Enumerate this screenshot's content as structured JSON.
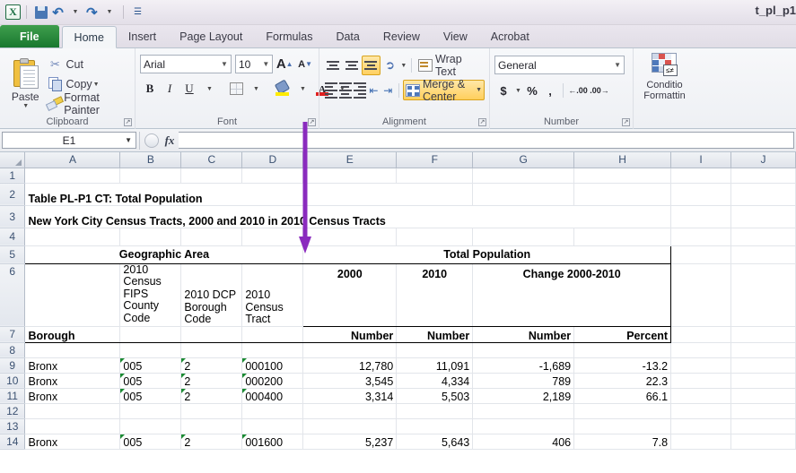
{
  "window": {
    "document_title": "t_pl_p1"
  },
  "quick_access": {
    "logo": "X",
    "items": [
      {
        "name": "save",
        "label": "Save"
      },
      {
        "name": "undo",
        "label": "Undo"
      },
      {
        "name": "redo",
        "label": "Redo"
      },
      {
        "name": "customize",
        "label": "Customize Quick Access Toolbar"
      }
    ]
  },
  "ribbon": {
    "tabs": [
      {
        "label": "File",
        "active": false,
        "file": true
      },
      {
        "label": "Home",
        "active": true
      },
      {
        "label": "Insert",
        "active": false
      },
      {
        "label": "Page Layout",
        "active": false
      },
      {
        "label": "Formulas",
        "active": false
      },
      {
        "label": "Data",
        "active": false
      },
      {
        "label": "Review",
        "active": false
      },
      {
        "label": "View",
        "active": false
      },
      {
        "label": "Acrobat",
        "active": false
      }
    ],
    "clipboard": {
      "group_label": "Clipboard",
      "paste": "Paste",
      "cut": "Cut",
      "copy": "Copy",
      "format_painter": "Format Painter"
    },
    "font": {
      "group_label": "Font",
      "font_name": "Arial",
      "font_size": "10",
      "grow_font": "A",
      "shrink_font": "A",
      "bold": "B",
      "italic": "I",
      "underline": "U",
      "font_color_letter": "A"
    },
    "alignment": {
      "group_label": "Alignment",
      "wrap_text": "Wrap Text",
      "merge_center": "Merge & Center"
    },
    "number": {
      "group_label": "Number",
      "format": "General",
      "currency": "$",
      "percent": "%",
      "comma": ",",
      "increase_decimal": ".00",
      "decrease_decimal": ".00"
    },
    "styles": {
      "conditional_formatting_line1": "Conditio",
      "conditional_formatting_line2": "Formattin"
    }
  },
  "formula_bar": {
    "name_box": "E1",
    "fx": "fx",
    "formula": ""
  },
  "grid": {
    "columns": [
      "A",
      "B",
      "C",
      "D",
      "E",
      "F",
      "G",
      "H",
      "I",
      "J"
    ],
    "rows": [
      "1",
      "2",
      "3",
      "4",
      "5",
      "6",
      "7",
      "8",
      "9",
      "10",
      "11",
      "12",
      "13",
      "14"
    ],
    "titles": {
      "row2": "Table PL-P1 CT:  Total Population",
      "row3": "New York City Census Tracts, 2000 and 2010 in 2010 Census Tracts"
    },
    "headers": {
      "geographic_area": "Geographic Area",
      "total_population": "Total Population",
      "year_2000": "2000",
      "year_2010": "2010",
      "change": "Change 2000-2010",
      "borough": "Borough",
      "fips_county_code": "2010 Census FIPS County Code",
      "dcp_borough_code": "2010 DCP Borough Code",
      "census_tract": "2010 Census Tract",
      "number_2000": "Number",
      "number_2010": "Number",
      "change_number": "Number",
      "change_percent": "Percent"
    },
    "data_rows": [
      {
        "row": "9",
        "borough": "Bronx",
        "fips": "005",
        "dcp": "2",
        "tract": "000100",
        "pop2000": "12,780",
        "pop2010": "11,091",
        "chg_num": "-1,689",
        "chg_pct": "-13.2"
      },
      {
        "row": "10",
        "borough": "Bronx",
        "fips": "005",
        "dcp": "2",
        "tract": "000200",
        "pop2000": "3,545",
        "pop2010": "4,334",
        "chg_num": "789",
        "chg_pct": "22.3"
      },
      {
        "row": "11",
        "borough": "Bronx",
        "fips": "005",
        "dcp": "2",
        "tract": "000400",
        "pop2000": "3,314",
        "pop2010": "5,503",
        "chg_num": "2,189",
        "chg_pct": "66.1"
      },
      {
        "row": "14",
        "borough": "Bronx",
        "fips": "005",
        "dcp": "2",
        "tract": "001600",
        "pop2000": "5,237",
        "pop2010": "5,643",
        "chg_num": "406",
        "chg_pct": "7.8"
      }
    ]
  },
  "annotation": {
    "arrow_color": "#8A2BBE"
  }
}
